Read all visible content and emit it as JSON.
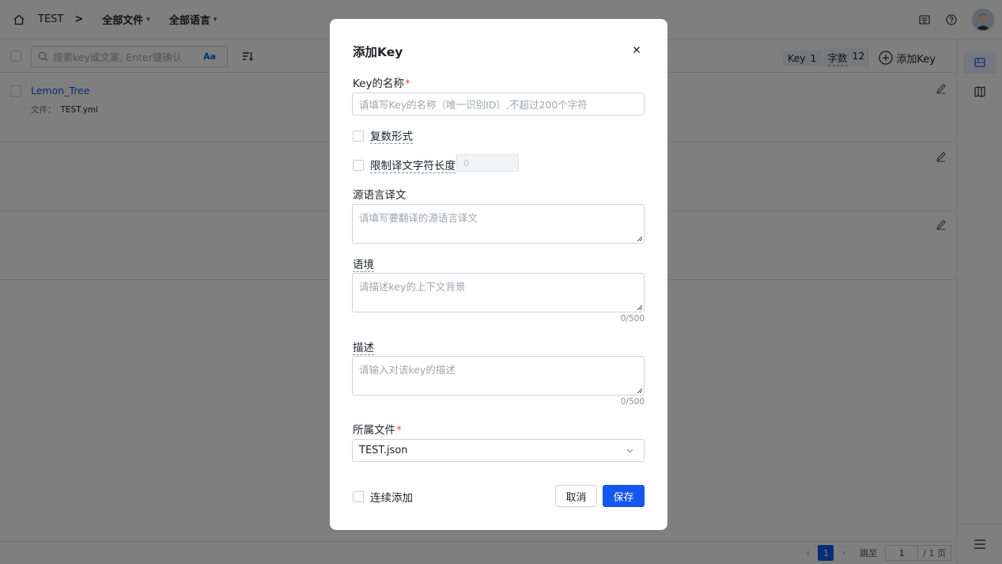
{
  "header": {
    "project": "TEST",
    "separator": ">",
    "file_filter": "全部文件",
    "lang_filter": "全部语言"
  },
  "toolbar": {
    "search_placeholder": "搜索key或文案, Enter键确认",
    "case_toggle": "Aa",
    "stats": {
      "key_label": "Key",
      "key_count": "1",
      "chars_label": "字数",
      "chars_count": "12"
    },
    "add_key_label": "添加Key"
  },
  "list": {
    "rows": [
      {
        "key": "Lemon_Tree",
        "file_label": "文件：",
        "file_name": "TEST.yml"
      }
    ]
  },
  "pagination": {
    "current_page": "1",
    "jump_label": "跳至",
    "jump_value": "1",
    "total_label": "/ 1 页"
  },
  "modal": {
    "title": "添加Key",
    "key_name": {
      "label": "Key的名称",
      "required_mark": "*",
      "placeholder": "请填写Key的名称（唯一识别ID）,不超过200个字符"
    },
    "plural": {
      "label": "复数形式",
      "checked": false
    },
    "limit_length": {
      "label": "限制译文字符长度",
      "checked": false,
      "value": "0"
    },
    "source_text": {
      "label": "源语言译文",
      "placeholder": "请填写要翻译的源语言译文"
    },
    "context": {
      "label": "语境",
      "placeholder": "请描述key的上下文背景",
      "counter": "0/500"
    },
    "description": {
      "label": "描述",
      "placeholder": "请输入对该key的描述",
      "counter": "0/500"
    },
    "file": {
      "label": "所属文件",
      "required_mark": "*",
      "value": "TEST.json"
    },
    "continuous": {
      "label": "连续添加",
      "checked": false
    },
    "cancel_label": "取消",
    "save_label": "保存"
  },
  "colors": {
    "primary": "#1456f0",
    "required": "#f54a45",
    "overlay": "rgba(0,0,0,0.5)"
  },
  "icons": [
    "home-icon",
    "chevron-down-icon",
    "keyboard-icon",
    "help-icon",
    "avatar",
    "search-icon",
    "sort-icon",
    "add-circle-icon",
    "edit-icon",
    "layout-icon",
    "book-icon",
    "menu-icon",
    "close-icon"
  ]
}
